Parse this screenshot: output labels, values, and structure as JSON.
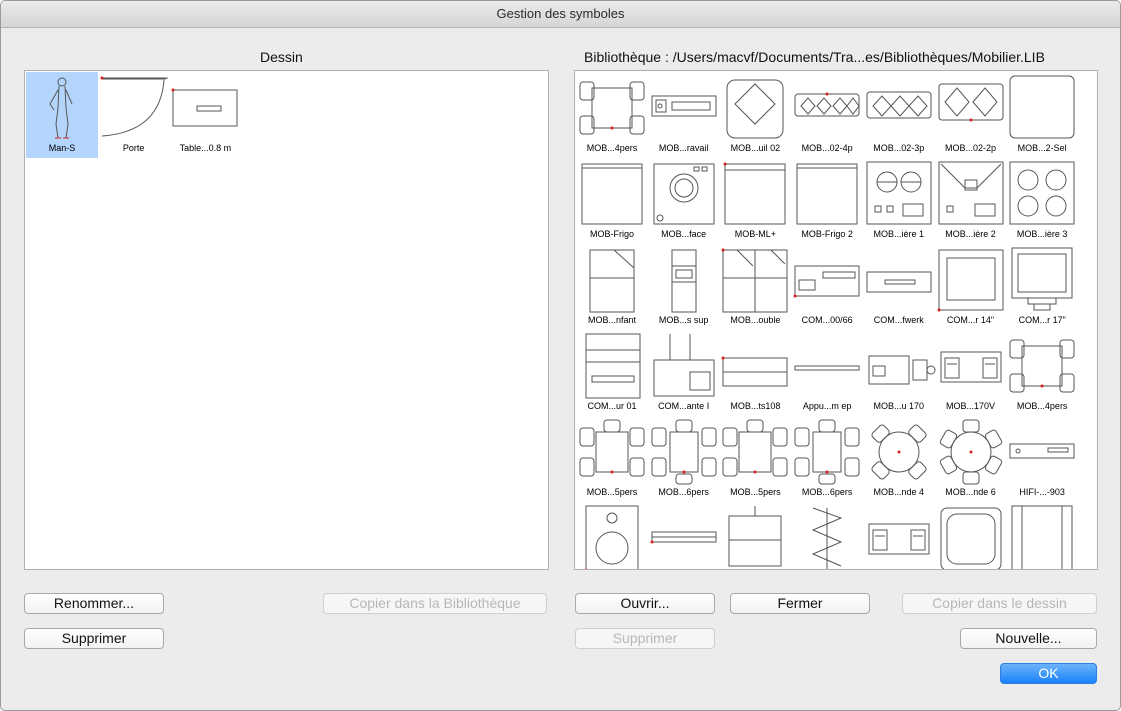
{
  "window": {
    "title": "Gestion des symboles"
  },
  "left": {
    "heading": "Dessin",
    "symbols": [
      {
        "label": "Man-S",
        "icon": "man-standing-icon",
        "selected": true
      },
      {
        "label": "Porte",
        "icon": "door-icon",
        "selected": false
      },
      {
        "label": "Table...0.8 m",
        "icon": "table-icon",
        "selected": false
      }
    ]
  },
  "right": {
    "heading": "Bibliothèque :  /Users/macvf/Documents/Tra...es/Bibliothèques/Mobilier.LIB",
    "symbols": [
      {
        "label": "MOB...4pers",
        "icon": "table-4-chairs-icon"
      },
      {
        "label": "MOB...ravail",
        "icon": "counter-icon"
      },
      {
        "label": "MOB...uil 02",
        "icon": "armchair-icon"
      },
      {
        "label": "MOB...02-4p",
        "icon": "sofa-4-icon"
      },
      {
        "label": "MOB...02-3p",
        "icon": "sofa-3-icon"
      },
      {
        "label": "MOB...02-2p",
        "icon": "sofa-2-icon"
      },
      {
        "label": "MOB...2-Sel",
        "icon": "rounded-box-icon"
      },
      {
        "label": "MOB-Frigo",
        "icon": "fridge-icon"
      },
      {
        "label": "MOB...face",
        "icon": "washing-machine-icon"
      },
      {
        "label": "MOB-ML+",
        "icon": "dishwasher-icon"
      },
      {
        "label": "MOB-Frigo 2",
        "icon": "fridge-icon"
      },
      {
        "label": "MOB...ière 1",
        "icon": "stove-2-icon"
      },
      {
        "label": "MOB...ière 2",
        "icon": "hood-icon"
      },
      {
        "label": "MOB...ière 3",
        "icon": "hob-4-icon"
      },
      {
        "label": "MOB...nfant",
        "icon": "cupboard-icon"
      },
      {
        "label": "MOB...s sup",
        "icon": "shelf-unit-icon"
      },
      {
        "label": "MOB...ouble",
        "icon": "double-cupboard-icon"
      },
      {
        "label": "COM...00/66",
        "icon": "computer-icon"
      },
      {
        "label": "COM...fwerk",
        "icon": "device-icon"
      },
      {
        "label": "COM...r 14\"",
        "icon": "monitor-icon"
      },
      {
        "label": "COM...r 17\"",
        "icon": "monitor-stand-icon"
      },
      {
        "label": "COM...ur 01",
        "icon": "tower-icon"
      },
      {
        "label": "COM...ante I",
        "icon": "printer-icon"
      },
      {
        "label": "MOB...ts108",
        "icon": "bench-icon"
      },
      {
        "label": "Appu...m ep",
        "icon": "ledge-icon"
      },
      {
        "label": "MOB...u 170",
        "icon": "desk-icon"
      },
      {
        "label": "MOB...170V",
        "icon": "desk-drawers-icon"
      },
      {
        "label": "MOB...4pers",
        "icon": "table-4-chairs-icon"
      },
      {
        "label": "MOB...5pers",
        "icon": "table-5-chairs-icon"
      },
      {
        "label": "MOB...6pers",
        "icon": "table-6-chairs-icon"
      },
      {
        "label": "MOB...5pers",
        "icon": "table-5-chairs-icon"
      },
      {
        "label": "MOB...6pers",
        "icon": "table-6-chairs-icon"
      },
      {
        "label": "MOB...nde 4",
        "icon": "round-table-4-icon"
      },
      {
        "label": "MOB...nde 6",
        "icon": "round-table-6-icon"
      },
      {
        "label": "HIFI-...-903",
        "icon": "hifi-icon"
      },
      {
        "label": "",
        "icon": "speaker-icon"
      },
      {
        "label": "",
        "icon": "cd-player-icon"
      },
      {
        "label": "",
        "icon": "cabinet-icon"
      },
      {
        "label": "",
        "icon": "stairs-icon"
      },
      {
        "label": "",
        "icon": "desk-drawers-icon"
      },
      {
        "label": "",
        "icon": "bathtub-icon"
      },
      {
        "label": "",
        "icon": "wardrobe-icon"
      }
    ]
  },
  "buttons": {
    "rename": "Renommer...",
    "copy_to_library": "Copier dans la Bibliothèque",
    "delete_left": "Supprimer",
    "open": "Ouvrir...",
    "close": "Fermer",
    "copy_to_drawing": "Copier dans le dessin",
    "delete_right": "Supprimer",
    "new": "Nouvelle...",
    "ok": "OK"
  },
  "colors": {
    "accent": "#1a82fb",
    "selection": "#b3d4fb",
    "marker": "#e02020"
  }
}
